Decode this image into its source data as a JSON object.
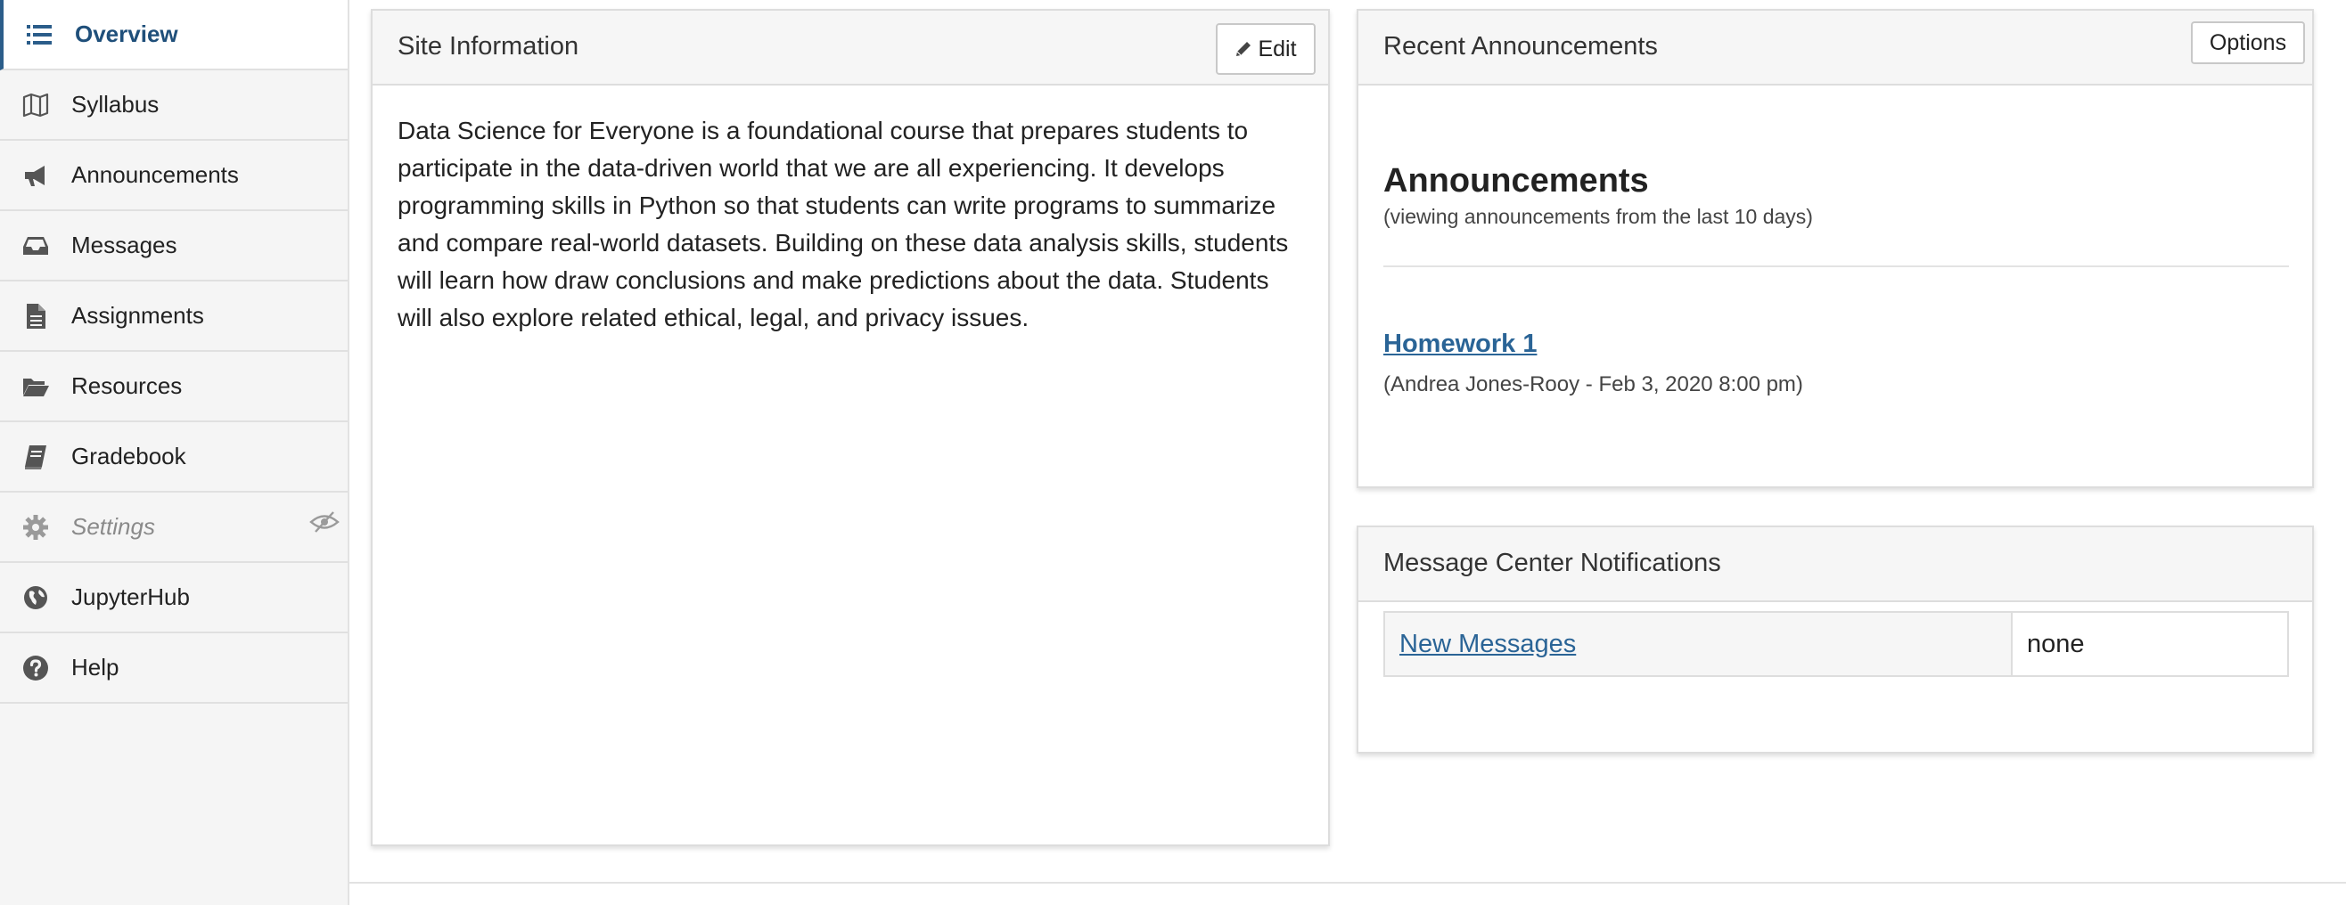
{
  "sidebar": {
    "items": [
      {
        "label": "Overview",
        "icon": "list-icon",
        "active": true
      },
      {
        "label": "Syllabus",
        "icon": "map-icon"
      },
      {
        "label": "Announcements",
        "icon": "bullhorn-icon"
      },
      {
        "label": "Messages",
        "icon": "inbox-icon"
      },
      {
        "label": "Assignments",
        "icon": "file-text-icon"
      },
      {
        "label": "Resources",
        "icon": "folder-open-icon"
      },
      {
        "label": "Gradebook",
        "icon": "book-icon"
      },
      {
        "label": "Settings",
        "icon": "gear-icon",
        "hidden": true
      },
      {
        "label": "JupyterHub",
        "icon": "globe-icon"
      },
      {
        "label": "Help",
        "icon": "question-circle-icon"
      }
    ]
  },
  "site_info": {
    "title": "Site Information",
    "edit_label": "Edit",
    "description": "Data Science for Everyone is a foundational course that prepares students to participate in the data-driven world that we are all experiencing. It develops programming skills in Python so that students can write programs to summarize and compare real-world datasets. Building on these data analysis skills, students will learn how draw conclusions and make predictions about the data. Students will also explore related ethical, legal, and privacy issues."
  },
  "announcements": {
    "title": "Recent Announcements",
    "options_label": "Options",
    "heading": "Announcements",
    "subheading": "(viewing announcements from the last 10 days)",
    "items": [
      {
        "title": "Homework 1",
        "meta": "(Andrea Jones-Rooy - Feb 3, 2020 8:00 pm)"
      }
    ]
  },
  "message_center": {
    "title": "Message Center Notifications",
    "rows": [
      {
        "label": "New Messages",
        "value": "none"
      }
    ]
  },
  "colors": {
    "link": "#2a6496",
    "active_nav": "#1f4f7a",
    "sidebar_bg": "#f5f5f5",
    "panel_header_bg": "#f6f6f6"
  }
}
